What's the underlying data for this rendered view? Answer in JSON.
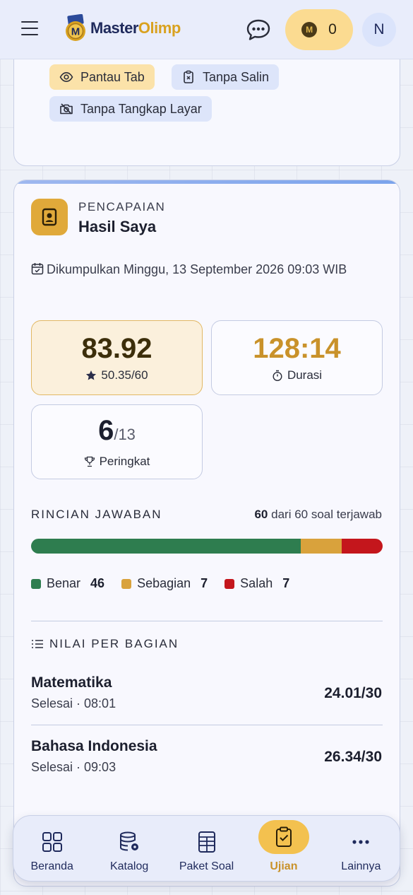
{
  "header": {
    "logo_part1": "Master",
    "logo_part2": "Olimp",
    "coin_count": "0",
    "avatar_initial": "N"
  },
  "restrictions": {
    "chips": [
      "Pantau Tab",
      "Tanpa Salin",
      "Tanpa Tangkap Layar"
    ]
  },
  "result": {
    "kicker": "PENCAPAIAN",
    "title": "Hasil Saya",
    "submitted": "Dikumpulkan Minggu, 13 September 2026 09:03 WIB",
    "score": "83.92",
    "score_points": "50.35/60",
    "duration": "128:14",
    "duration_label": "Durasi",
    "rank": "6",
    "rank_total": "/13",
    "rank_label": "Peringkat"
  },
  "answers": {
    "label": "RINCIAN JAWABAN",
    "answered": "60",
    "answered_suffix": "dari 60 soal terjawab",
    "correct_label": "Benar",
    "correct": 46,
    "partial_label": "Sebagian",
    "partial": 7,
    "wrong_label": "Salah",
    "wrong": 7
  },
  "sections": {
    "label": "NILAI PER BAGIAN",
    "items": [
      {
        "name": "Matematika",
        "meta": "Selesai · 08:01",
        "score": "24.01/30"
      },
      {
        "name": "Bahasa Indonesia",
        "meta": "Selesai · 09:03",
        "score": "26.34/30"
      }
    ]
  },
  "nav": {
    "items": [
      "Beranda",
      "Katalog",
      "Paket Soal",
      "Ujian",
      "Lainnya"
    ],
    "active": "Ujian"
  },
  "colors": {
    "accent": "#e0a93a",
    "correct": "#2e7d4f",
    "partial": "#d9a23c",
    "wrong": "#c4161c"
  }
}
